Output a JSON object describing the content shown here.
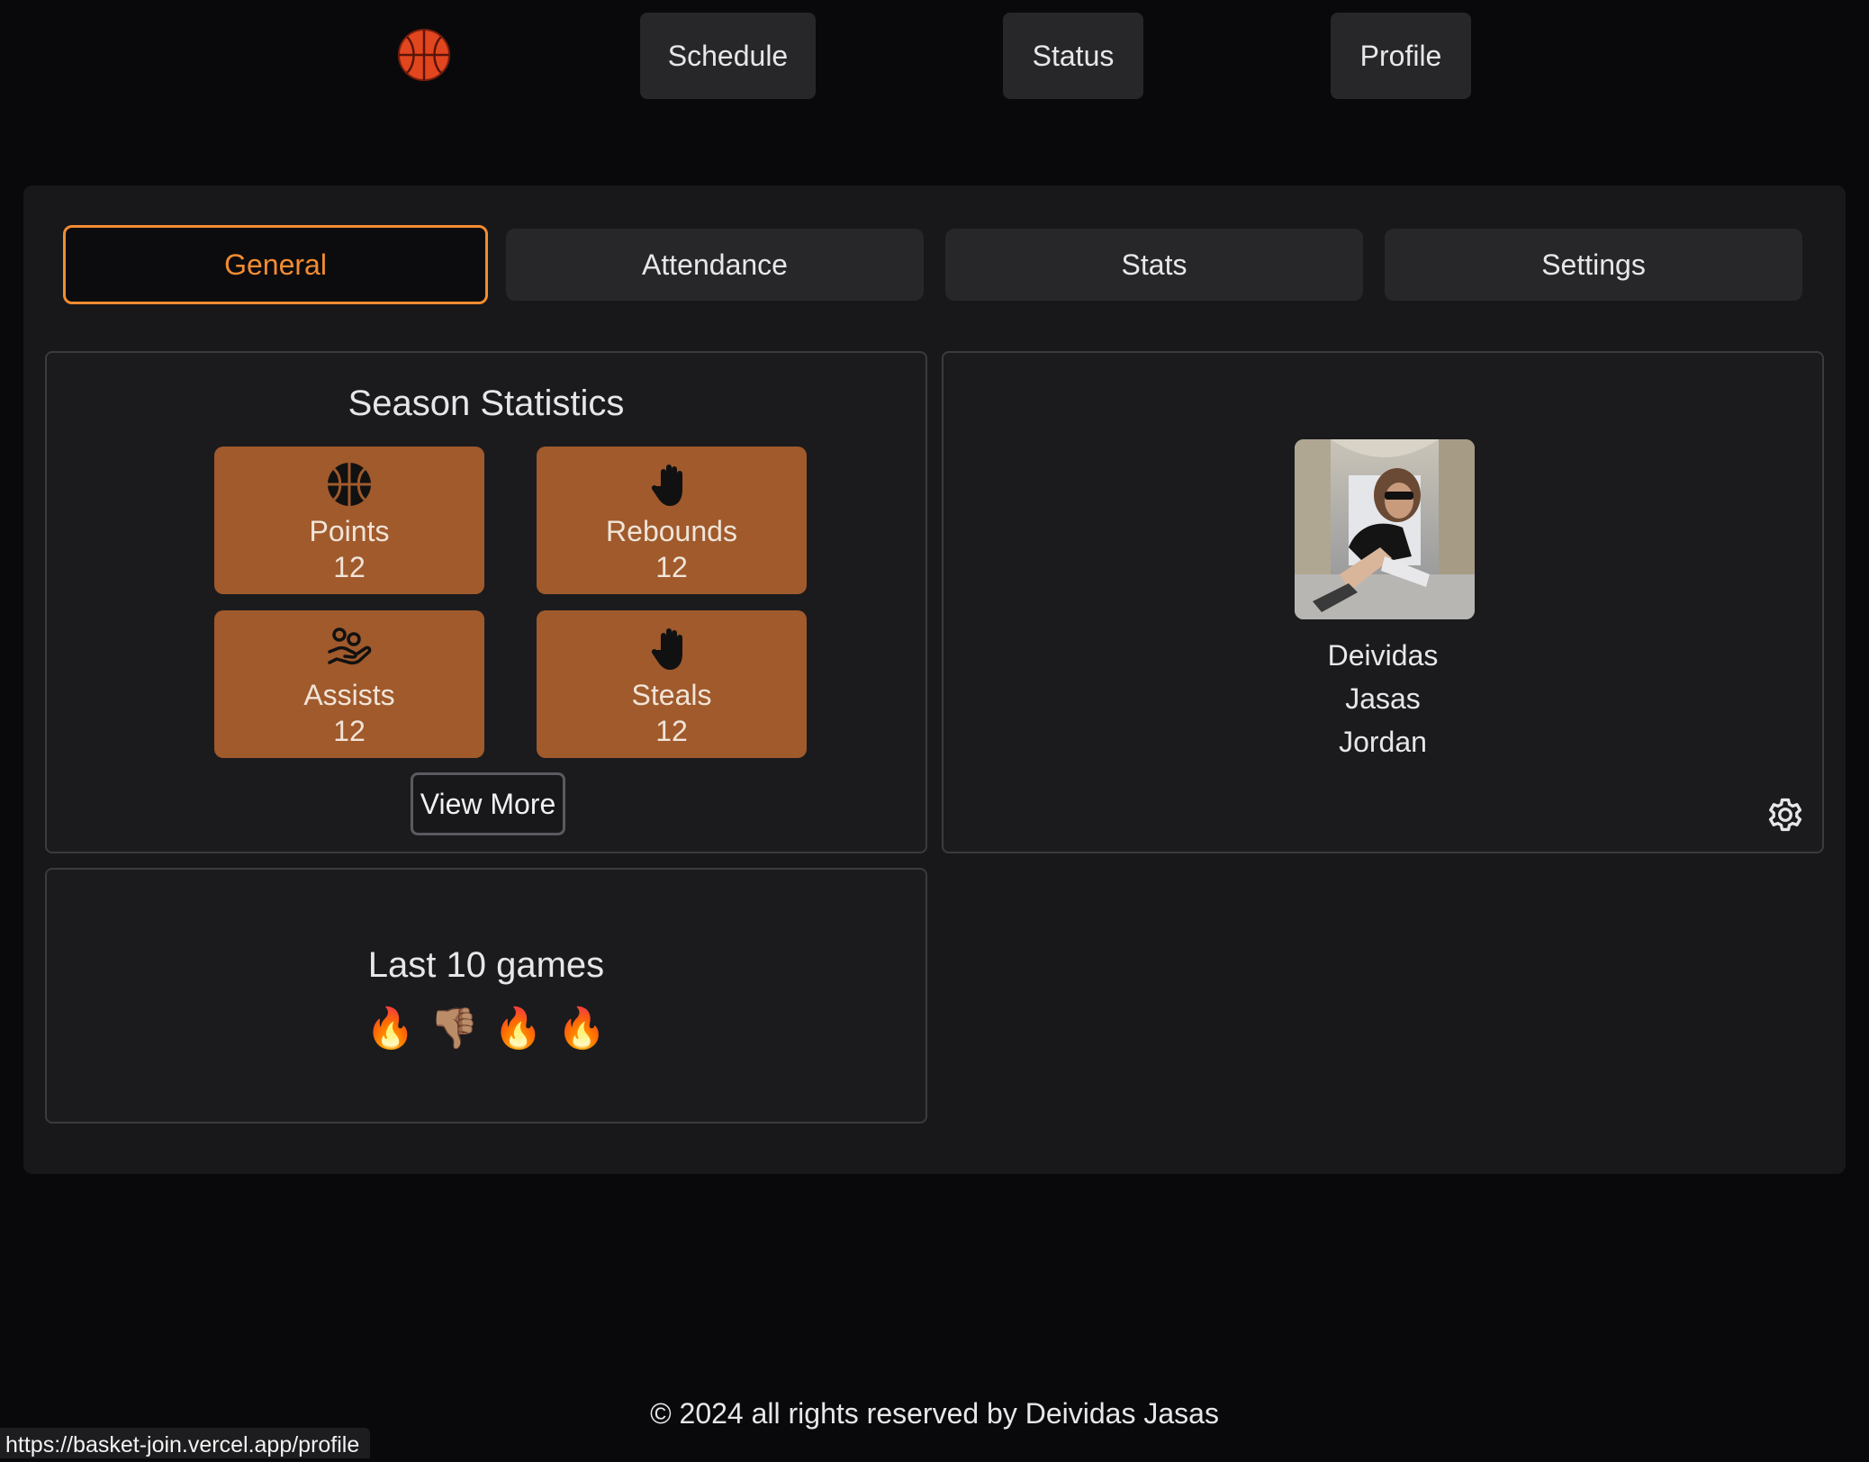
{
  "nav": {
    "logo_icon": "basketball-icon",
    "buttons": [
      "Schedule",
      "Status",
      "Profile"
    ]
  },
  "tabs": [
    {
      "label": "General",
      "active": true
    },
    {
      "label": "Attendance",
      "active": false
    },
    {
      "label": "Stats",
      "active": false
    },
    {
      "label": "Settings",
      "active": false
    }
  ],
  "season": {
    "title": "Season Statistics",
    "stats": [
      {
        "icon": "basketball-icon",
        "label": "Points",
        "value": "12"
      },
      {
        "icon": "hand-icon",
        "label": "Rebounds",
        "value": "12"
      },
      {
        "icon": "hand-holding-icon",
        "label": "Assists",
        "value": "12"
      },
      {
        "icon": "hand-icon",
        "label": "Steals",
        "value": "12"
      }
    ],
    "view_more": "View More"
  },
  "profile": {
    "name_lines": [
      "Deividas",
      "Jasas",
      "Jordan"
    ],
    "settings_icon": "gear-icon"
  },
  "last_games": {
    "title": "Last 10 games",
    "results": [
      "🔥",
      "👎🏽",
      "🔥",
      "🔥"
    ]
  },
  "footer": "© 2024 all rights reserved by Deividas Jasas",
  "status_url": "https://basket-join.vercel.app/profile",
  "colors": {
    "accent": "#f28c32",
    "tile": "#a05a2c",
    "background": "#09090b",
    "card": "#18181b"
  }
}
